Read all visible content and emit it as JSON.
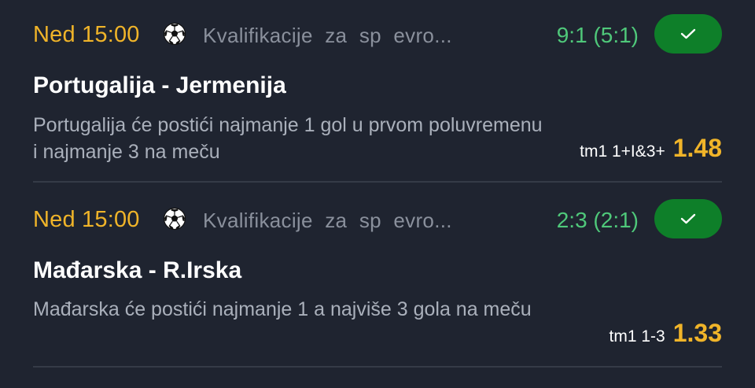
{
  "bets": [
    {
      "time": "Ned 15:00",
      "sport_icon": "soccer-ball-icon",
      "league": "Kvalifikacije za sp evro...",
      "score": "9:1 (5:1)",
      "status_icon": "check-icon",
      "match": "Portugalija - Jermenija",
      "description": "Portugalija će postići najmanje 1 gol u prvom poluvremenu i najmanje 3 na meču",
      "market": "tm1 1+I&3+",
      "odd": "1.48"
    },
    {
      "time": "Ned 15:00",
      "sport_icon": "soccer-ball-icon",
      "league": "Kvalifikacije za sp evro...",
      "score": "2:3 (2:1)",
      "status_icon": "check-icon",
      "match": "Mađarska - R.Irska",
      "description": "Mađarska će postići najmanje 1 a najviše 3 gola na meču",
      "market": "tm1 1-3",
      "odd": "1.33"
    }
  ],
  "colors": {
    "background": "#1f2430",
    "time": "#f0b429",
    "score_win": "#4fc87a",
    "status_button": "#0e7f29",
    "odd": "#f0b429"
  }
}
